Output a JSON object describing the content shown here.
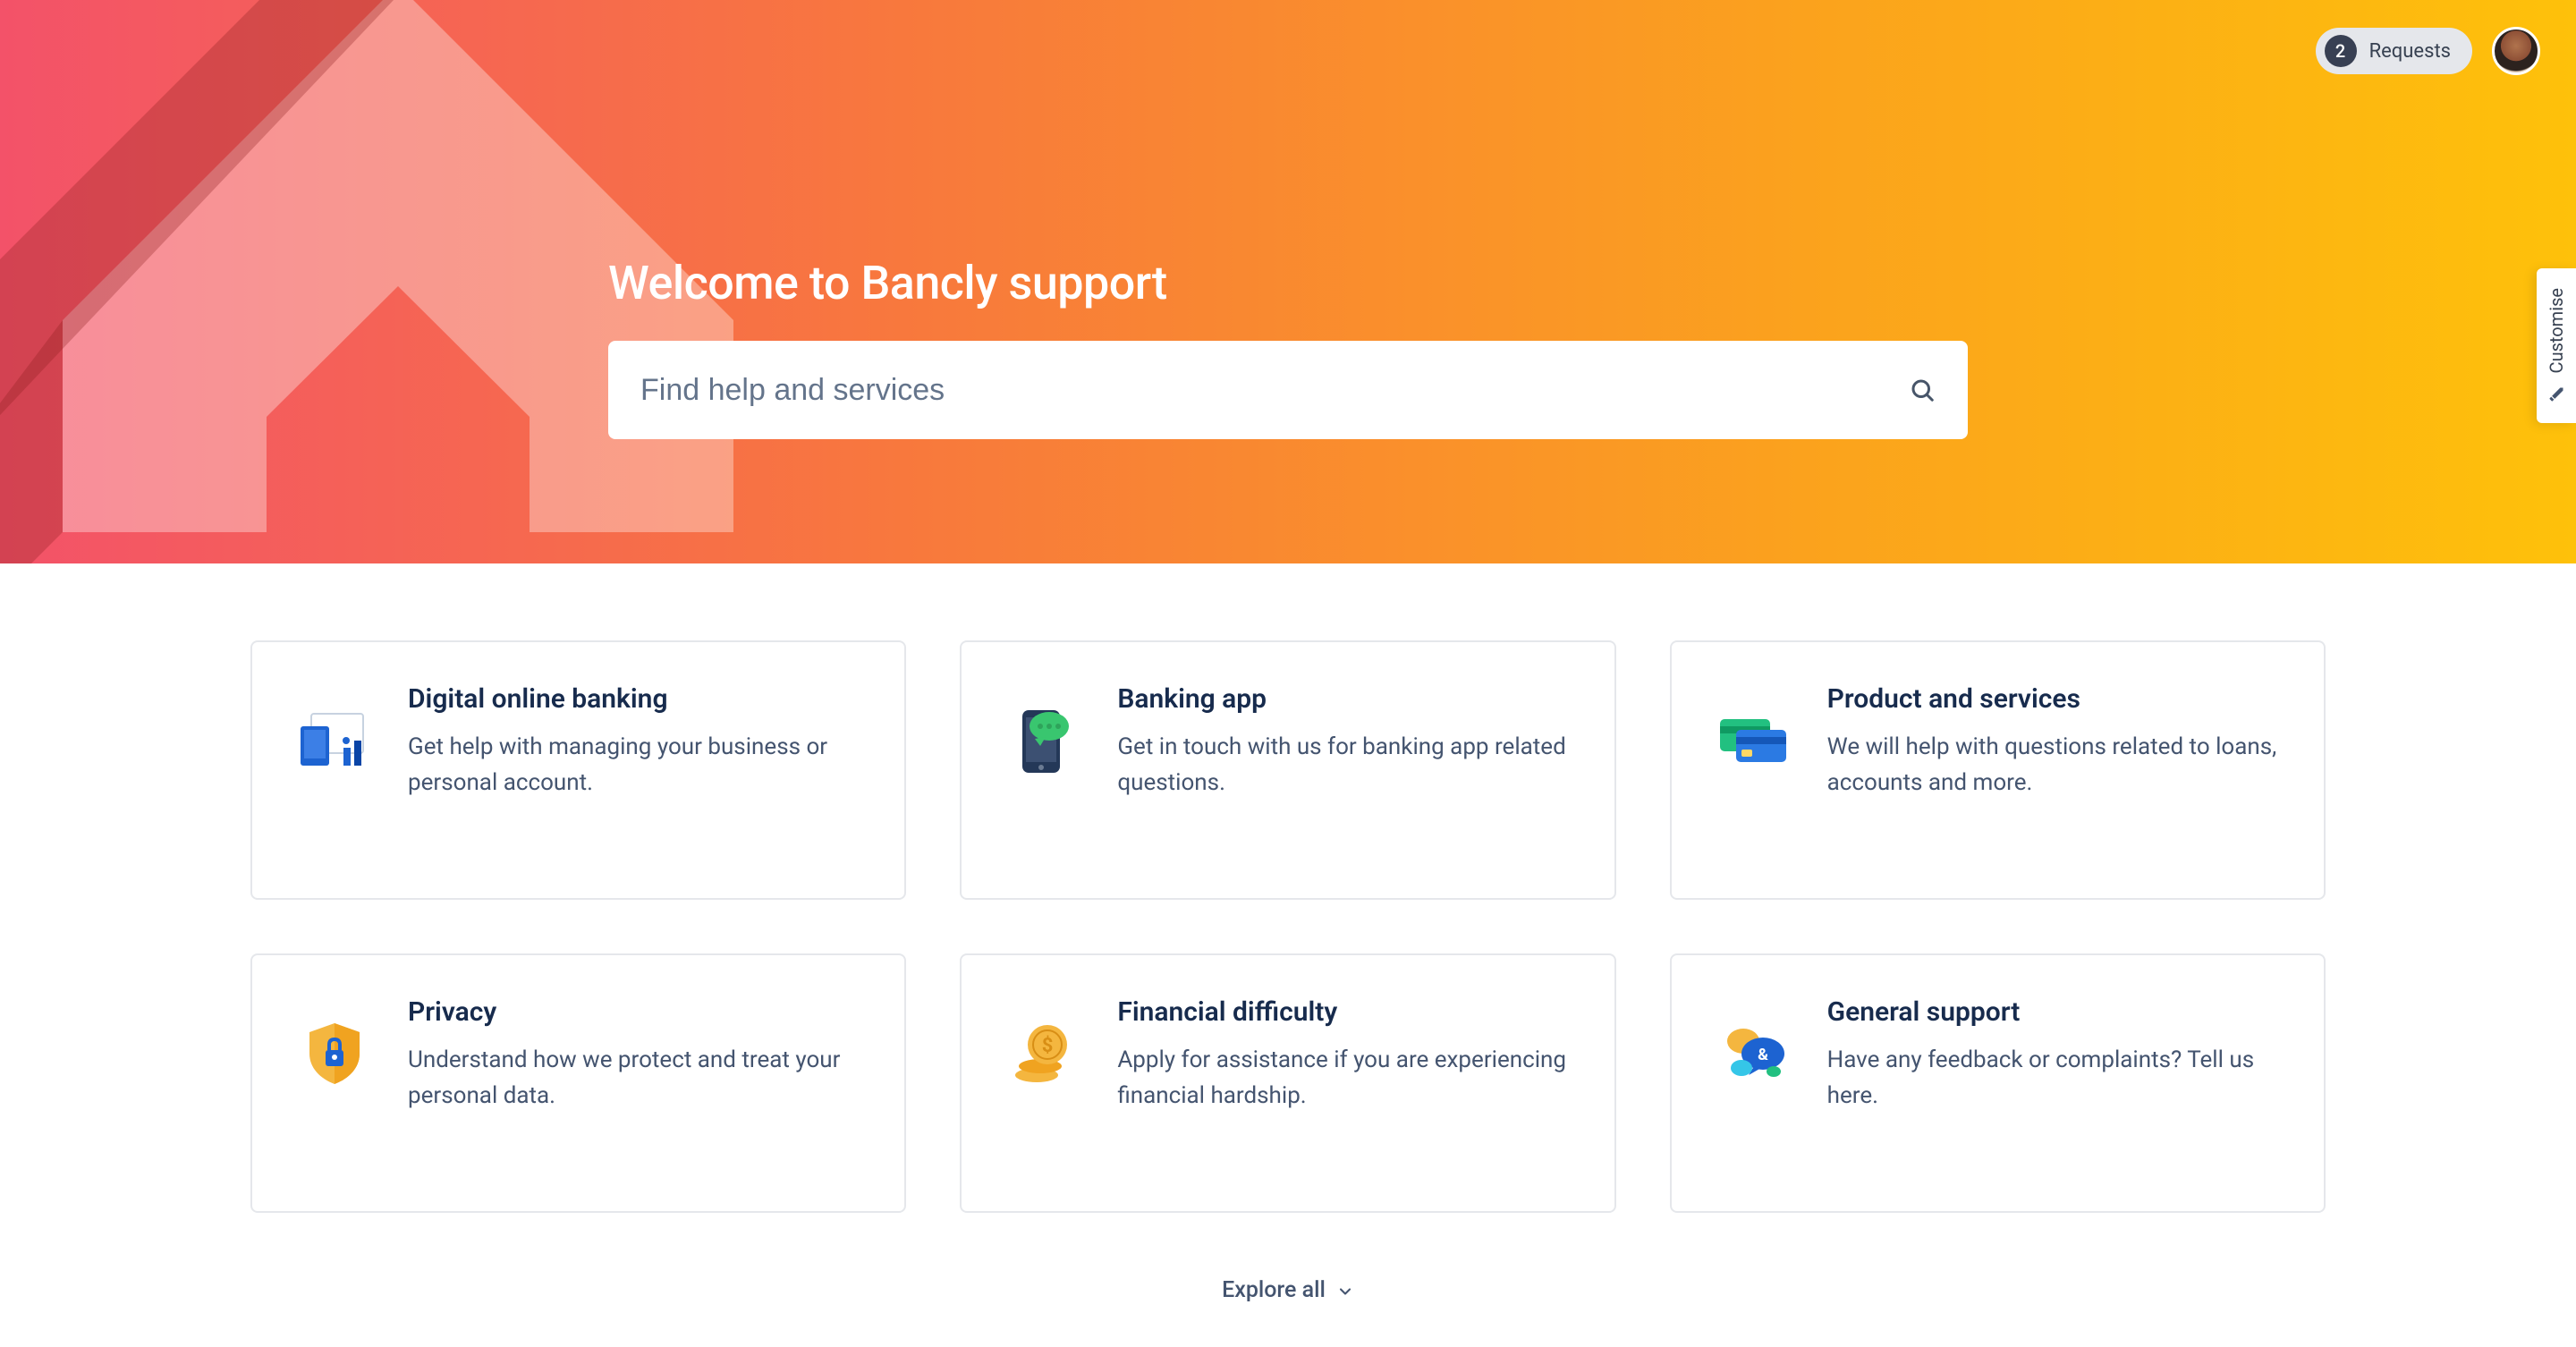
{
  "header": {
    "requests_count": "2",
    "requests_label": "Requests"
  },
  "customise_label": "Customise",
  "hero": {
    "title": "Welcome to Bancly support",
    "search_placeholder": "Find help and services"
  },
  "cards": [
    {
      "title": "Digital online banking",
      "desc": "Get help with managing your business or personal account."
    },
    {
      "title": "Banking app",
      "desc": "Get in touch with us for banking app related questions."
    },
    {
      "title": "Product and services",
      "desc": "We will help with questions related to loans, accounts and more."
    },
    {
      "title": "Privacy",
      "desc": "Understand how we protect and treat your personal data."
    },
    {
      "title": "Financial difficulty",
      "desc": "Apply for assistance if you are experiencing financial hardship."
    },
    {
      "title": "General support",
      "desc": "Have any feedback or complaints? Tell us here."
    }
  ],
  "explore_all_label": "Explore all"
}
